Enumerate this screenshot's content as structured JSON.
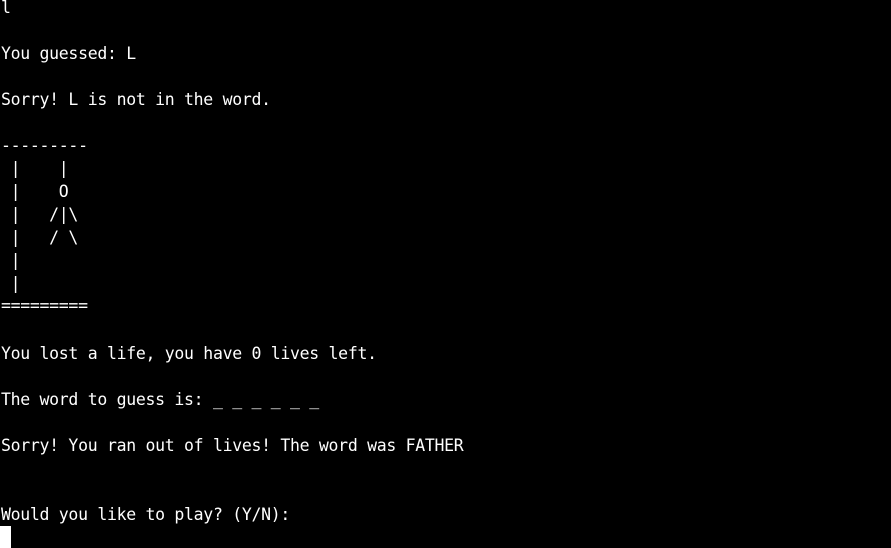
{
  "terminal": {
    "lines": {
      "input_echo": "l",
      "guessed": "You guessed: L",
      "sorry_not_in_word": "Sorry! L is not in the word.",
      "gallows_top": "---------",
      "gallows_row1": " |    |",
      "gallows_row2": " |    O",
      "gallows_row3": " |   /|\\",
      "gallows_row4": " |   / \\",
      "gallows_row5": " |",
      "gallows_row6": " |",
      "gallows_base": "=========",
      "lost_life": "You lost a life, you have 0 lives left.",
      "word_to_guess": "The word to guess is: _ _ _ _ _ _",
      "out_of_lives": "Sorry! You ran out of lives! The word was FATHER",
      "play_prompt": "Would you like to play? (Y/N):"
    },
    "colors": {
      "background": "#000000",
      "foreground": "#ffffff"
    }
  }
}
